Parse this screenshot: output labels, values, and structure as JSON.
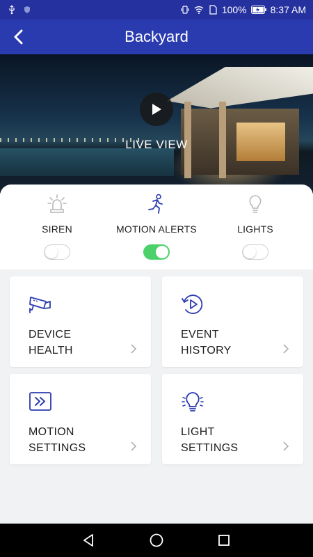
{
  "status_bar": {
    "battery": "100%",
    "time": "8:37 AM"
  },
  "header": {
    "title": "Backyard",
    "back_icon": "back-arrow-icon"
  },
  "hero": {
    "live_label": "LIVE VIEW",
    "play_icon": "play-icon"
  },
  "toggles": [
    {
      "label": "SIREN",
      "icon": "siren-icon",
      "on": false
    },
    {
      "label": "MOTION ALERTS",
      "icon": "running-person-icon",
      "on": true
    },
    {
      "label": "LIGHTS",
      "icon": "lightbulb-icon",
      "on": false
    }
  ],
  "tiles": [
    {
      "line1": "DEVICE",
      "line2": "HEALTH",
      "icon": "camera-health-icon"
    },
    {
      "line1": "EVENT",
      "line2": "HISTORY",
      "icon": "history-play-icon"
    },
    {
      "line1": "MOTION",
      "line2": "SETTINGS",
      "icon": "motion-settings-icon"
    },
    {
      "line1": "LIGHT",
      "line2": "SETTINGS",
      "icon": "light-settings-icon"
    }
  ],
  "colors": {
    "primary": "#2a3bb0",
    "status_bar": "#25319f",
    "icon_blue": "#2a3bb0",
    "toggle_on": "#4bd06a"
  }
}
